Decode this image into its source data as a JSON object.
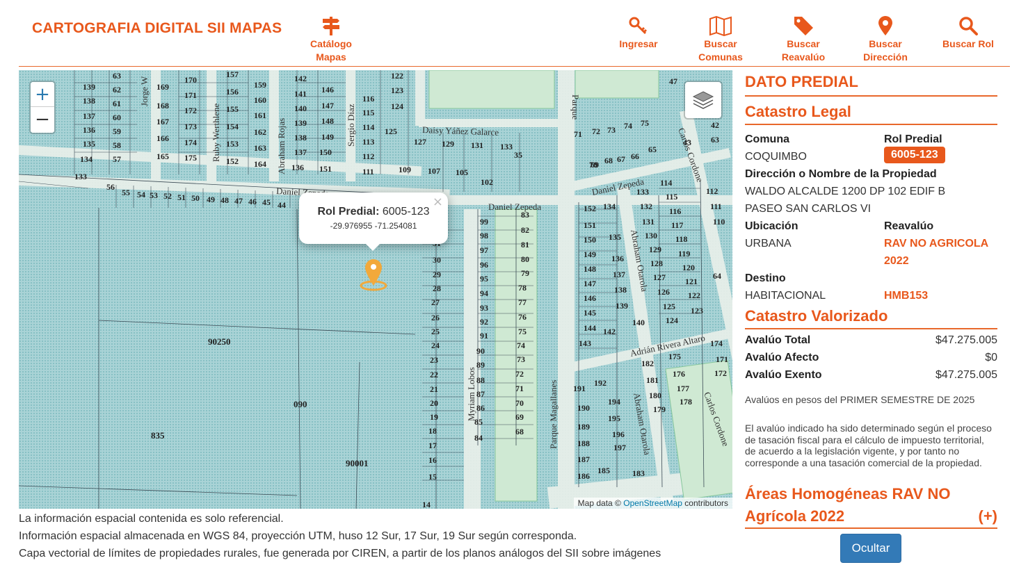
{
  "header": {
    "brand": "CARTOGRAFIA DIGITAL SII MAPAS",
    "nav": [
      {
        "line1": "Catálogo",
        "line2": "Mapas",
        "icon": "signpost-icon"
      },
      {
        "line1": "Ingresar",
        "line2": "",
        "icon": "key-icon"
      },
      {
        "line1": "Buscar",
        "line2": "Comunas",
        "icon": "map-icon"
      },
      {
        "line1": "Buscar",
        "line2": "Reavalúo",
        "icon": "tag-icon"
      },
      {
        "line1": "Buscar",
        "line2": "Dirección",
        "icon": "pin-icon"
      },
      {
        "line1": "Buscar Rol",
        "line2": "",
        "icon": "search-icon"
      }
    ],
    "accent": "#e8581c"
  },
  "map": {
    "zoom_in": "+",
    "zoom_out": "−",
    "attribution_prefix": "Map data ©",
    "attribution_link": "OpenStreetMap",
    "attribution_suffix": "contributors",
    "popup": {
      "label": "Rol Predial:",
      "value": "6005-123",
      "coords": "-29.976955   -71.254081",
      "close": "×"
    },
    "streets": [
      "Daniel Zepeda",
      "Daniel Zepeda",
      "Daisy Yáñez Galarce",
      "Daniel Zepeda",
      "Abraham Rojas",
      "Sergio Díaz",
      "Ruby Werthlene",
      "Jorge W",
      "Myriam Lobos",
      "Parque Magallanes",
      "Abraham Otarola",
      "Abraham Otarola",
      "Carlos Cordone",
      "Carlos Cordone",
      "Adrián Rivera Altaro",
      "Parque"
    ],
    "parcels": [
      "90250",
      "090",
      "835",
      "90001"
    ],
    "lots": [
      "63",
      "62",
      "61",
      "60",
      "59",
      "58",
      "57",
      "139",
      "138",
      "137",
      "136",
      "135",
      "134",
      "133",
      "169",
      "168",
      "167",
      "166",
      "165",
      "170",
      "171",
      "172",
      "173",
      "174",
      "175",
      "157",
      "156",
      "155",
      "154",
      "153",
      "152",
      "159",
      "160",
      "161",
      "162",
      "163",
      "164",
      "142",
      "141",
      "140",
      "139",
      "138",
      "137",
      "136",
      "146",
      "147",
      "148",
      "149",
      "150",
      "151",
      "122",
      "123",
      "124",
      "116",
      "115",
      "114",
      "113",
      "112",
      "111",
      "125",
      "127",
      "129",
      "131",
      "133",
      "135",
      "109",
      "107",
      "105",
      "102",
      "56",
      "55",
      "54",
      "53",
      "52",
      "51",
      "50",
      "49",
      "48",
      "47",
      "46",
      "45",
      "44",
      "99",
      "98",
      "97",
      "96",
      "95",
      "94",
      "93",
      "92",
      "91",
      "90",
      "89",
      "88",
      "87",
      "86",
      "85",
      "84",
      "83",
      "82",
      "81",
      "80",
      "79",
      "78",
      "77",
      "76",
      "75",
      "74",
      "73",
      "72",
      "71",
      "70",
      "69",
      "68",
      "31",
      "30",
      "29",
      "28",
      "27",
      "26",
      "25",
      "24",
      "23",
      "22",
      "21",
      "20",
      "19",
      "18",
      "17",
      "16",
      "15",
      "14",
      "71",
      "72",
      "73",
      "74",
      "75",
      "70",
      "69",
      "68",
      "67",
      "66",
      "65",
      "152",
      "151",
      "150",
      "149",
      "148",
      "147",
      "146",
      "145",
      "144",
      "143",
      "134",
      "135",
      "136",
      "137",
      "138",
      "139",
      "142",
      "140",
      "133",
      "132",
      "131",
      "130",
      "129",
      "128",
      "127",
      "126",
      "125",
      "124",
      "114",
      "115",
      "116",
      "117",
      "118",
      "119",
      "120",
      "121",
      "122",
      "123",
      "112",
      "111",
      "110",
      "47",
      "42",
      "43",
      "63",
      "64",
      "191",
      "190",
      "189",
      "188",
      "187",
      "186",
      "192",
      "194",
      "195",
      "196",
      "197",
      "185",
      "183",
      "182",
      "181",
      "180",
      "179",
      "175",
      "176",
      "177",
      "178",
      "174",
      "172",
      "171"
    ]
  },
  "notes": [
    "La información espacial contenida es solo referencial.",
    "Información espacial almacenada en WGS 84, proyección UTM, huso 12 Sur, 17 Sur, 19 Sur según corresponda.",
    "Capa vectorial de límites de propiedades rurales, fue generada por CIREN, a partir de los planos análogos del SII sobre imágenes"
  ],
  "panel": {
    "title": "DATO PREDIAL",
    "legal_title": "Catastro Legal",
    "comuna_label": "Comuna",
    "comuna": "COQUIMBO",
    "rol_label": "Rol Predial",
    "rol": "6005-123",
    "direccion_label": "Dirección o Nombre de la Propiedad",
    "direccion_line1": "WALDO ALCALDE 1200 DP 102 EDIF B",
    "direccion_line2": "PASEO SAN CARLOS VI",
    "ubicacion_label": "Ubicación",
    "ubicacion": "URBANA",
    "reavaluo_label": "Reavalúo",
    "reavaluo_line1": "RAV NO AGRICOLA",
    "reavaluo_line2": "2022",
    "destino_label": "Destino",
    "destino": "HABITACIONAL",
    "hmb": "HMB153",
    "valorizado_title": "Catastro Valorizado",
    "avaluo_total_label": "Avalúo Total",
    "avaluo_total": "$47.275.005",
    "avaluo_afecto_label": "Avalúo Afecto",
    "avaluo_afecto": "$0",
    "avaluo_exento_label": "Avalúo Exento",
    "avaluo_exento": "$47.275.005",
    "semestre_note": "Avalúos en pesos del PRIMER SEMESTRE DE 2025",
    "disclaimer": "El avalúo indicado ha sido determinado según el proceso de tasación fiscal para el cálculo de impuesto territorial, de acuerdo a la legislación vigente, y por tanto no corresponde a una tasación comercial de la propiedad.",
    "areas_line1": "Áreas Homogéneas RAV NO",
    "areas_line2": "Agrícola 2022",
    "areas_toggle": "(+)",
    "hide_button": "Ocultar"
  }
}
